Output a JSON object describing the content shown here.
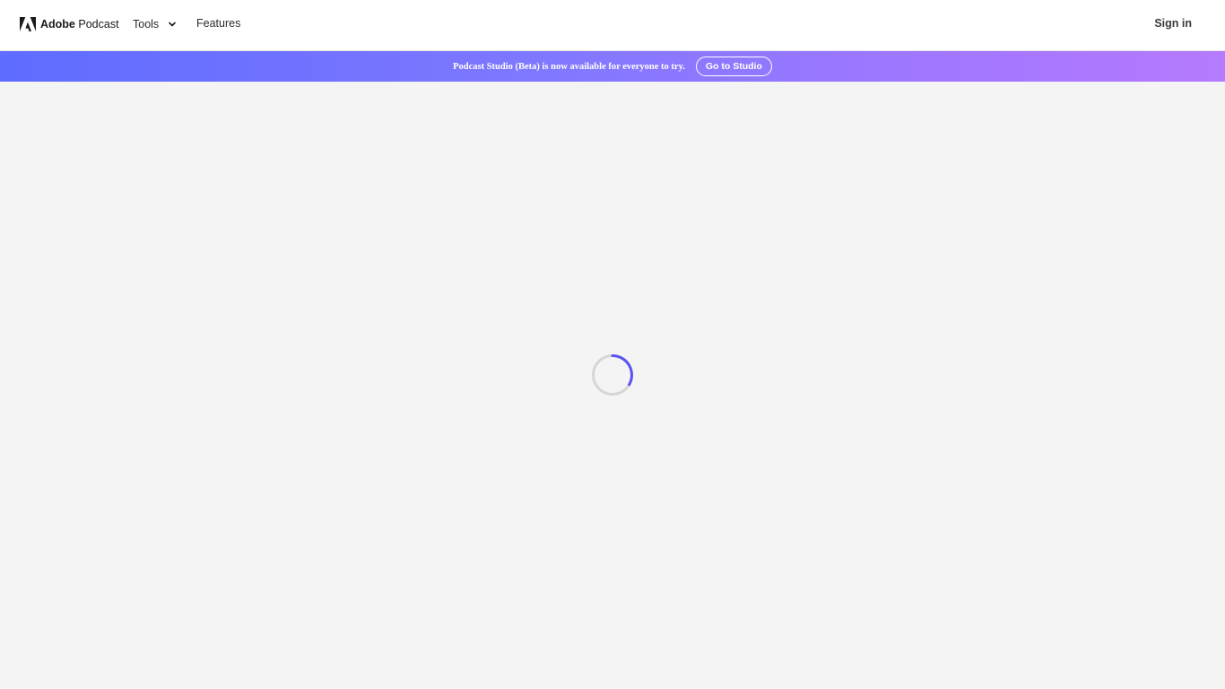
{
  "header": {
    "brand_bold": "Adobe",
    "brand_name": "Podcast",
    "logo_icon": "adobe-logo-icon",
    "nav": {
      "tools_label": "Tools",
      "tools_icon": "chevron-down-icon",
      "features_label": "Features"
    },
    "signin_label": "Sign in"
  },
  "banner": {
    "message": "Podcast Studio (Beta) is now available for everyone to try.",
    "button_label": "Go to Studio",
    "gradient_colors": [
      "#5e6cff",
      "#b57aff"
    ]
  },
  "main": {
    "loading_icon": "loading-spinner-icon",
    "spinner_accent": "#5a55f0"
  }
}
